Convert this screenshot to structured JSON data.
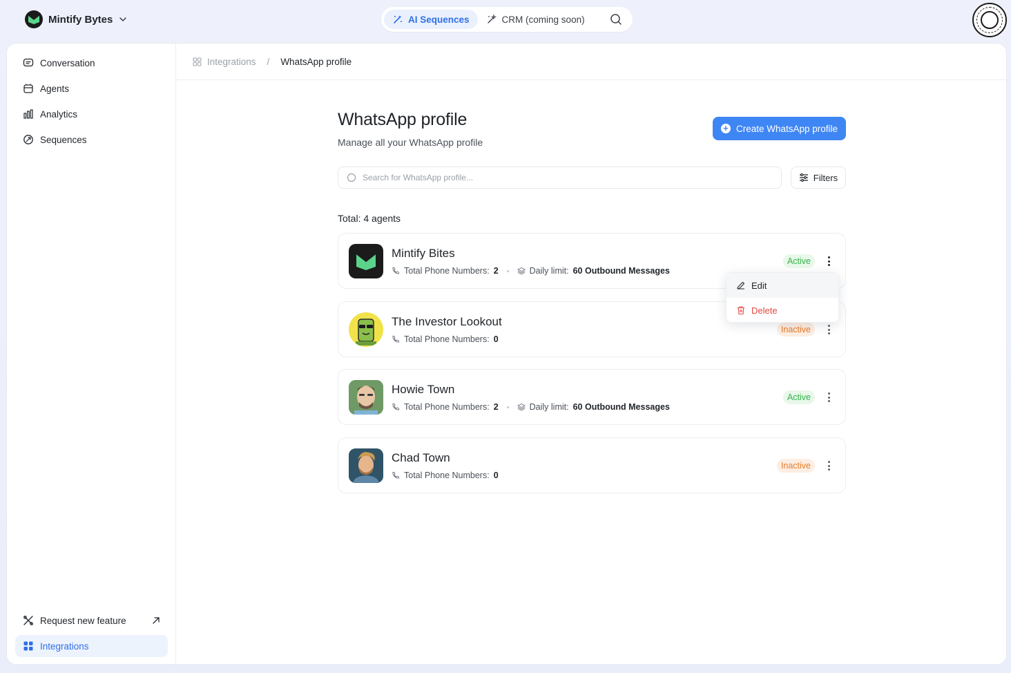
{
  "workspace": {
    "name": "Mintify Bytes",
    "logo_icon": "mintify-logo-icon"
  },
  "topnav": {
    "tabs": [
      {
        "label": "AI Sequences",
        "icon": "sparkle-icon",
        "active": true
      },
      {
        "label": "CRM (coming soon)",
        "icon": "magic-wand-icon",
        "active": false
      }
    ],
    "search_icon": "search-icon"
  },
  "sidebar": {
    "items": [
      {
        "label": "Conversation",
        "icon": "chat-icon"
      },
      {
        "label": "Agents",
        "icon": "agents-icon"
      },
      {
        "label": "Analytics",
        "icon": "bar-chart-icon"
      },
      {
        "label": "Sequences",
        "icon": "sequences-icon"
      }
    ],
    "bottom": [
      {
        "label": "Request new feature",
        "icon": "tools-icon",
        "trailing_icon": "arrow-up-right-icon"
      },
      {
        "label": "Integrations",
        "icon": "grid-icon",
        "active": true
      }
    ]
  },
  "breadcrumb": {
    "root": "Integrations",
    "separator": "/",
    "current": "WhatsApp profile"
  },
  "page": {
    "title": "WhatsApp profile",
    "subtitle": "Manage all your WhatsApp profile",
    "create_button": "Create WhatsApp profile",
    "search_placeholder": "Search for WhatsApp profile...",
    "filters_label": "Filters",
    "total_label": "Total: 4 agents"
  },
  "profiles": [
    {
      "name": "Mintify Bites",
      "phones_label": "Total Phone Numbers:",
      "phones": "2",
      "limit_label": "Daily limit:",
      "limit": "60 Outbound Messages",
      "status": "Active"
    },
    {
      "name": "The Investor Lookout",
      "phones_label": "Total Phone Numbers:",
      "phones": "0",
      "status": "Inactive"
    },
    {
      "name": "Howie Town",
      "phones_label": "Total Phone Numbers:",
      "phones": "2",
      "limit_label": "Daily limit:",
      "limit": "60 Outbound Messages",
      "status": "Active"
    },
    {
      "name": "Chad Town",
      "phones_label": "Total Phone Numbers:",
      "phones": "0",
      "status": "Inactive"
    }
  ],
  "context_menu": {
    "edit": "Edit",
    "delete": "Delete"
  },
  "colors": {
    "accent": "#3f86f5",
    "active_green": "#34b24a",
    "inactive_orange": "#e67d2b",
    "delete_red": "#e2483d"
  }
}
